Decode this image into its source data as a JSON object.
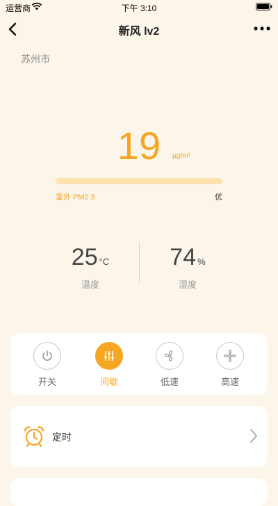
{
  "status_bar": {
    "carrier": "运营商",
    "time": "下午 3:10"
  },
  "nav": {
    "title": "新风 lv2"
  },
  "location": {
    "city": "苏州市"
  },
  "pm25": {
    "value": "19",
    "unit": "μg/m³",
    "label": "室外 PM2.5",
    "grade": "优"
  },
  "indoor": {
    "temperature": {
      "value": "25",
      "unit": "°C",
      "label": "温度"
    },
    "humidity": {
      "value": "74",
      "unit": "%",
      "label": "湿度"
    }
  },
  "modes": [
    {
      "label": "开关",
      "icon": "power-icon",
      "active": false
    },
    {
      "label": "间歇",
      "icon": "sliders-icon",
      "active": true
    },
    {
      "label": "低速",
      "icon": "fan-low-icon",
      "active": false
    },
    {
      "label": "高速",
      "icon": "fan-high-icon",
      "active": false
    }
  ],
  "timer": {
    "label": "定时",
    "icon": "alarm-clock-icon"
  },
  "colors": {
    "accent": "#f5a623",
    "background": "#fcf5ea",
    "bar": "#fde2b0"
  }
}
